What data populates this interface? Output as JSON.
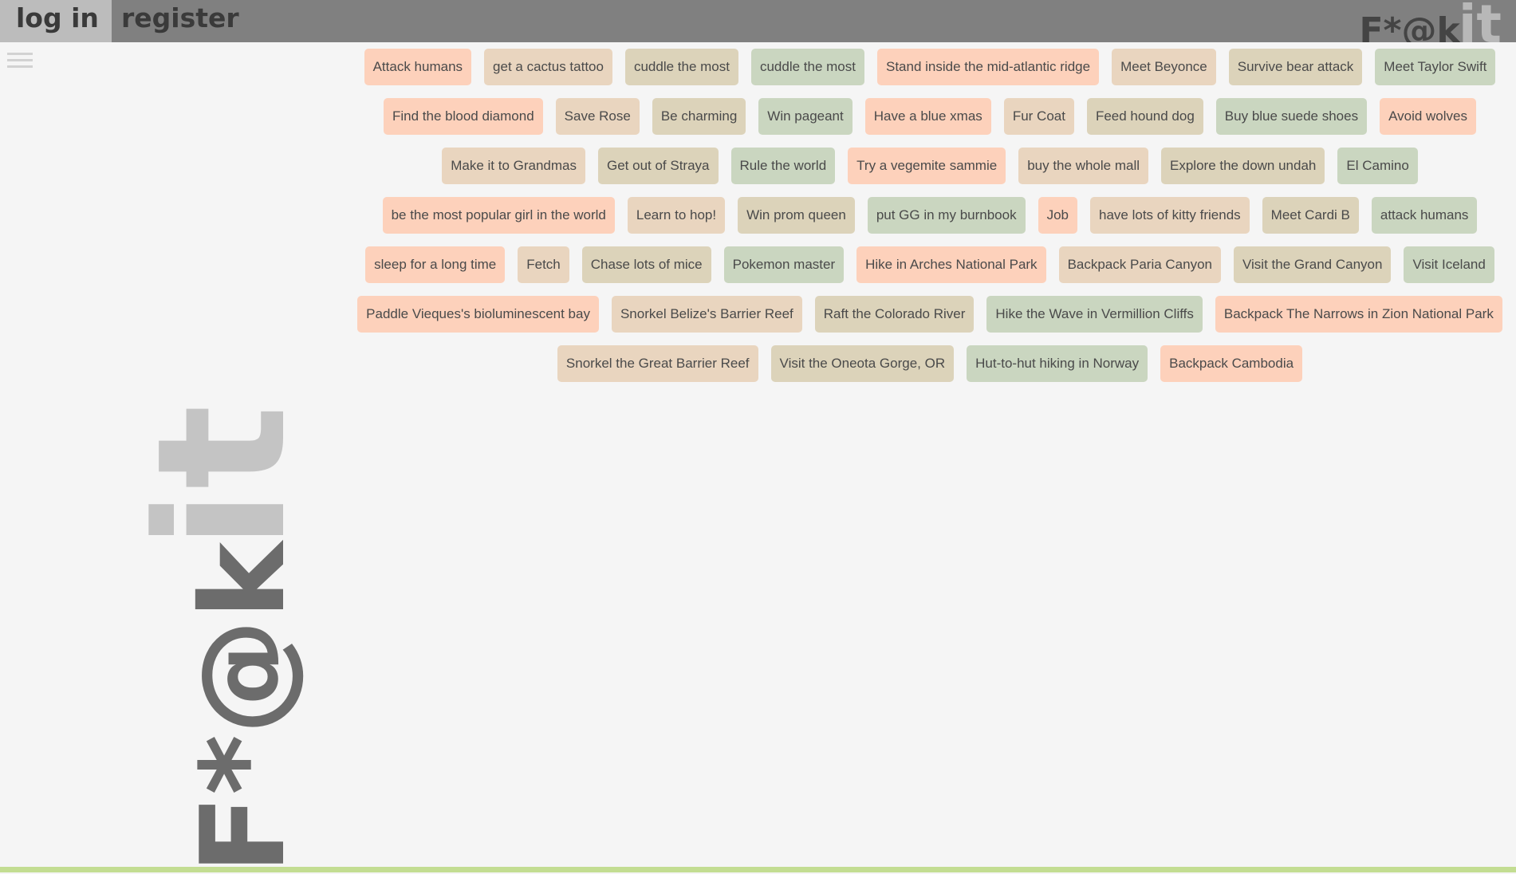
{
  "nav": {
    "login_label": "log in",
    "register_label": "register"
  },
  "logo": {
    "main": "F*@k",
    "suffix": "it"
  },
  "colors": {
    "peach": "#fdd1bb",
    "tan": "#e9d5bf",
    "khaki": "#dcd3ba",
    "sage": "#cad6c0",
    "topbar": "#808080",
    "accent_line": "#c3dd92"
  },
  "goals": [
    [
      {
        "label": "Attack humans",
        "color": "peach"
      },
      {
        "label": "get a cactus tattoo",
        "color": "tan"
      },
      {
        "label": "cuddle the most",
        "color": "khaki"
      },
      {
        "label": "cuddle the most",
        "color": "sage"
      },
      {
        "label": "Stand inside the mid-atlantic ridge",
        "color": "peach"
      },
      {
        "label": "Meet Beyonce",
        "color": "tan"
      },
      {
        "label": "Survive bear attack",
        "color": "khaki"
      },
      {
        "label": "Meet Taylor Swift",
        "color": "sage"
      }
    ],
    [
      {
        "label": "Find the blood diamond",
        "color": "peach"
      },
      {
        "label": "Save Rose",
        "color": "tan"
      },
      {
        "label": "Be charming",
        "color": "khaki"
      },
      {
        "label": "Win pageant",
        "color": "sage"
      },
      {
        "label": "Have a blue xmas",
        "color": "peach"
      },
      {
        "label": "Fur Coat",
        "color": "tan"
      },
      {
        "label": "Feed hound dog",
        "color": "khaki"
      },
      {
        "label": "Buy blue suede shoes",
        "color": "sage"
      },
      {
        "label": "Avoid wolves",
        "color": "peach"
      }
    ],
    [
      {
        "label": "Make it to Grandmas",
        "color": "tan"
      },
      {
        "label": "Get out of Straya",
        "color": "khaki"
      },
      {
        "label": "Rule the world",
        "color": "sage"
      },
      {
        "label": "Try a vegemite sammie",
        "color": "peach"
      },
      {
        "label": "buy the whole mall",
        "color": "tan"
      },
      {
        "label": "Explore the down undah",
        "color": "khaki"
      },
      {
        "label": "El Camino",
        "color": "sage"
      }
    ],
    [
      {
        "label": "be the most popular girl in the world",
        "color": "peach"
      },
      {
        "label": "Learn to hop!",
        "color": "tan"
      },
      {
        "label": "Win prom queen",
        "color": "khaki"
      },
      {
        "label": "put GG in my burnbook",
        "color": "sage"
      },
      {
        "label": "Job",
        "color": "peach"
      },
      {
        "label": "have lots of kitty friends",
        "color": "tan"
      },
      {
        "label": "Meet Cardi B",
        "color": "khaki"
      },
      {
        "label": "attack humans",
        "color": "sage"
      }
    ],
    [
      {
        "label": "sleep for a long time",
        "color": "peach"
      },
      {
        "label": "Fetch",
        "color": "tan"
      },
      {
        "label": "Chase lots of mice",
        "color": "khaki"
      },
      {
        "label": "Pokemon master",
        "color": "sage"
      },
      {
        "label": "Hike in Arches National Park",
        "color": "peach"
      },
      {
        "label": "Backpack Paria Canyon",
        "color": "tan"
      },
      {
        "label": "Visit the Grand Canyon",
        "color": "khaki"
      },
      {
        "label": "Visit Iceland",
        "color": "sage"
      }
    ],
    [
      {
        "label": "Paddle Vieques's bioluminescent bay",
        "color": "peach"
      },
      {
        "label": "Snorkel Belize's Barrier Reef",
        "color": "tan"
      },
      {
        "label": "Raft the Colorado River",
        "color": "khaki"
      },
      {
        "label": "Hike the Wave in Vermillion Cliffs",
        "color": "sage"
      },
      {
        "label": "Backpack The Narrows in Zion National Park",
        "color": "peach"
      }
    ],
    [
      {
        "label": "Snorkel the Great Barrier Reef",
        "color": "tan"
      },
      {
        "label": "Visit the Oneota Gorge, OR",
        "color": "khaki"
      },
      {
        "label": "Hut-to-hut hiking in Norway",
        "color": "sage"
      },
      {
        "label": "Backpack Cambodia",
        "color": "peach"
      }
    ]
  ]
}
